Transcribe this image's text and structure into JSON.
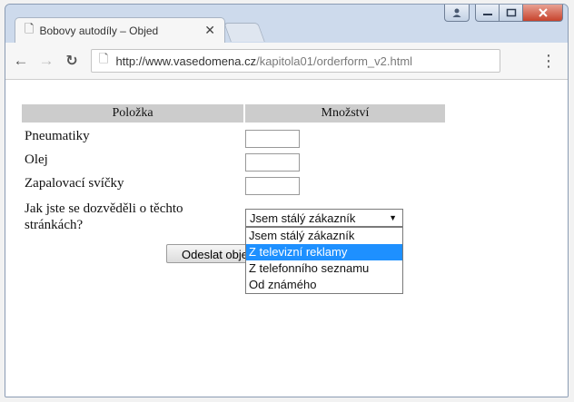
{
  "browser": {
    "tab_title": "Bobovy autodíly – Objed",
    "url_host": "http://www.vasedomena.cz",
    "url_path": "/kapitola01/orderform_v2.html"
  },
  "form": {
    "headers": [
      "Položka",
      "Množství"
    ],
    "items": [
      {
        "label": "Pneumatiky",
        "value": ""
      },
      {
        "label": "Olej",
        "value": ""
      },
      {
        "label": "Zapalovací svíčky",
        "value": ""
      }
    ],
    "question_line1": "Jak jste se dozvěděli o těchto",
    "question_line2": "stránkách?",
    "select_value": "Jsem stálý zákazník",
    "options": [
      "Jsem stálý zákazník",
      "Z televizní reklamy",
      "Z telefonního seznamu",
      "Od známého"
    ],
    "highlighted_option": "Z televizní reklamy",
    "submit_label": "Odeslat objednávku"
  },
  "icons": {
    "tab_page": "page-icon",
    "tab_close": "close-icon",
    "back": "back-arrow-icon",
    "forward": "forward-arrow-icon",
    "reload": "reload-icon",
    "menu": "menu-dots-icon"
  },
  "colors": {
    "window_frame": "#cfdcec",
    "header_bg": "#cccccc",
    "highlight": "#1e90ff"
  }
}
